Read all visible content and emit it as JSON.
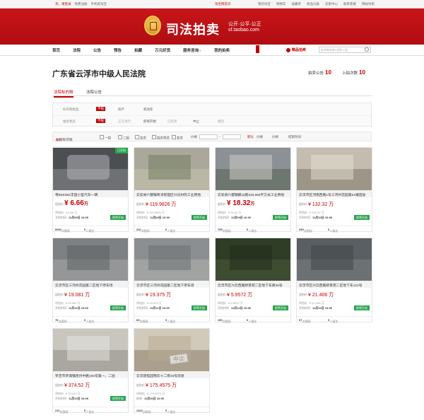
{
  "topbar": {
    "left": [
      "亲，请登录",
      "免费注册",
      "手机逛淘宝"
    ],
    "center": "淘宝网首页",
    "right": [
      "我的淘宝",
      "购物车",
      "收藏夹",
      "商品分类",
      "卖家中心",
      "联系客服",
      "网站导航"
    ]
  },
  "brand": {
    "title": "司法拍卖",
    "slogan": "公开·公平·公正",
    "domain": "sf.taobao.com"
  },
  "nav": {
    "items": [
      "首页",
      "法院",
      "公告",
      "预告",
      "拍藏",
      "万元好货",
      "服务咨询",
      "我的拍卖"
    ],
    "hot": "精品拍卖",
    "search_placeholder": "标的物名称/法院/公告"
  },
  "court": {
    "name": "广东省云浮市中级人民法院",
    "notice_label": "拍卖公告",
    "notice_count": "10",
    "times_label": "上拍次数",
    "times_count": "10"
  },
  "tabs": [
    "法院标的物",
    "法院公告"
  ],
  "filters": {
    "row1": {
      "label": "标的物类型",
      "options": [
        "不限",
        "房产",
        "机动车"
      ]
    },
    "row2": {
      "label": "拍卖状态",
      "options": [
        "不限",
        "正在进行",
        "即将开始",
        "已结束",
        "中止",
        "撤回"
      ]
    }
  },
  "sortbar": {
    "label": "标的物/宗数",
    "count": "(10)",
    "checks": [
      "一拍",
      "二拍",
      "变卖",
      "拍卖预览",
      "变卖"
    ],
    "price_label": "价格",
    "default_sort": "默认",
    "sorts": [
      "价格",
      "价格",
      "结束时间"
    ]
  },
  "cards": [
    {
      "title": "粤B5K682丰田小型汽车一辆",
      "price_label": "起拍价",
      "price": "6.66",
      "unit": "万",
      "eval_label": "评估价",
      "eval": "¥ 6.66 万",
      "time_label": "开拍时间",
      "time": "11月06日 10:00",
      "btn": "即将开始",
      "views": "6902",
      "views_label": "次围观",
      "signups": "0",
      "signups_label": "人报名",
      "tag": "已开拍"
    },
    {
      "title": "云安县六都镇青湾管理区兴乐村的工业用地",
      "price_label": "起拍价",
      "price": "¥ 119.9826 万",
      "eval_label": "评估价",
      "eval": "¥ 119.9826 万",
      "time_label": "开拍时间",
      "time": "11月09日 10:00",
      "btn": "即将开始",
      "views": "241",
      "views_label": "次围观",
      "signups": "0",
      "signups_label": "人报名"
    },
    {
      "title": "云安县六都镇鹏山路348.665平方米工业用地",
      "price_label": "起拍价",
      "price": "18.32",
      "unit": "万",
      "eval_label": "评估价",
      "eval": "¥ 18.32 万",
      "time_label": "开拍时间",
      "time": "11月09日 10:00",
      "btn": "即将开始",
      "views": "705",
      "views_label": "次围观",
      "signups": "0",
      "signups_label": "人报名"
    },
    {
      "title": "云浮市区河南西路1号三河州花园第21幢首层",
      "price_label": "起拍价",
      "price": "¥ 132.32 万",
      "eval_label": "评估价",
      "eval": "¥ 132.32 万",
      "time_label": "开拍时间",
      "time": "11月10日 10:00",
      "btn": "即将开始",
      "views": "330",
      "views_label": "次围观",
      "signups": "0",
      "signups_label": "人报名"
    },
    {
      "title": "云浮市区三河州花园第二区地下停车场",
      "price_label": "起拍价",
      "price": "¥ 19.081 万",
      "eval_label": "评估价",
      "eval": "¥ 19.081 万",
      "time_label": "开拍时间",
      "time": "11月11日 10:00",
      "btn": "即将开始",
      "views": "76",
      "views_label": "次围观",
      "signups": "0",
      "signups_label": "人报名"
    },
    {
      "title": "云浮市区三河州花园第二区地下停车场",
      "price_label": "起拍价",
      "price": "¥ 19.375 万",
      "eval_label": "评估价",
      "eval": "¥ 19.375 万",
      "time_label": "开拍时间",
      "time": "11月11日 10:00",
      "btn": "即将开始",
      "views": "63",
      "views_label": "次围观",
      "signups": "0",
      "signups_label": "人报名"
    },
    {
      "title": "云浮市区兴云西路新景苑二区地下车库35号",
      "price_label": "起拍价",
      "price": "¥ 5.9572 万",
      "eval_label": "评估价",
      "eval": "¥ 5.9572 万",
      "time_label": "开拍时间",
      "time": "11月12日 10:00",
      "btn": "即将开始",
      "views": "190",
      "views_label": "次围观",
      "signups": "0",
      "signups_label": "人报名"
    },
    {
      "title": "云浮市区兴云西路新景苑二区地下车122号",
      "price_label": "起拍价",
      "price": "¥ 21.406 万",
      "eval_label": "评估价",
      "eval": "¥ 21.406 万",
      "time_label": "开拍时间",
      "time": "11月12日 10:00",
      "btn": "即将开始",
      "views": "67",
      "views_label": "次围观",
      "signups": "0",
      "signups_label": "人报名"
    },
    {
      "title": "罗定市罗城镇连州中路105号第一、二层",
      "price_label": "起拍价",
      "price": "¥ 374.52 万",
      "eval_label": "评估价",
      "eval": "¥ 374.52 万",
      "time_label": "开拍时间",
      "time": "11月13日 10:00",
      "btn": "即将开始",
      "views": "211",
      "views_label": "次围观",
      "signups": "0",
      "signups_label": "人报名"
    },
    {
      "title": "云浮碧桂园锦云十二街33号房屋",
      "price_label": "起拍价",
      "price": "¥ 175.4575 万",
      "eval_label": "评估价",
      "eval": "¥ 175.4575 万",
      "time_label": "结束",
      "time": "11月30日 10:00",
      "btn": "",
      "views": "1122",
      "views_label": "次围观",
      "signups": "0",
      "signups_label": "人报名",
      "stamp": "中止"
    }
  ],
  "colors": {
    "brand_red": "#c40000",
    "green_button": "#2aa44f"
  }
}
